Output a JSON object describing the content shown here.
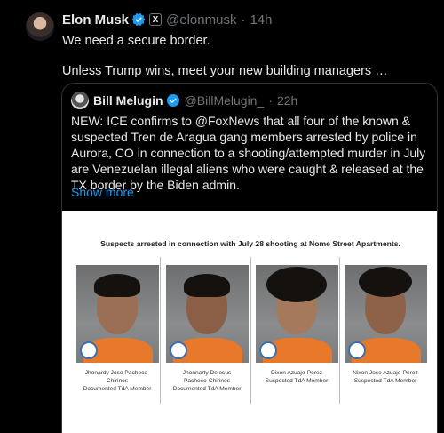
{
  "tweet": {
    "author_name": "Elon Musk",
    "handle": "@elonmusk",
    "separator": "·",
    "time": "14h",
    "badge_label": "X",
    "text_line1": "We need a secure border.",
    "text_line2": "Unless Trump wins, meet your new building managers …"
  },
  "quote": {
    "author_name": "Bill Melugin",
    "handle": "@BillMelugin_",
    "separator": "·",
    "time": "22h",
    "text": "NEW: ICE confirms to @FoxNews that all four of the known & suspected Tren de Aragua gang members arrested by police in Aurora, CO in connection to a shooting/attempted murder in July are Venezuelan illegal aliens who were caught & released at the TX border by the Biden admin.",
    "show_more": "Show more"
  },
  "image": {
    "title": "Suspects arrested in connection with July 28 shooting at Nome Street Apartments.",
    "captions": [
      {
        "line1": "Jhonardy Jose Pacheco-",
        "line2": "Chirinos",
        "line3": "Documented TdA Member"
      },
      {
        "line1": "Jhonnarty Dejesus",
        "line2": "Pacheco-Chirinos",
        "line3": "Documented TdA Member"
      },
      {
        "line1": "Dixon Azuaje-Perez",
        "line2": "Suspected TdA Member",
        "line3": ""
      },
      {
        "line1": "Nixon Jose Azuaje-Perez",
        "line2": "Suspected TdA Member",
        "line3": ""
      }
    ]
  },
  "colors": {
    "verified": "#1d9bf0",
    "muted": "#71767b",
    "link": "#1d9bf0",
    "shirt": "#e8782a"
  }
}
